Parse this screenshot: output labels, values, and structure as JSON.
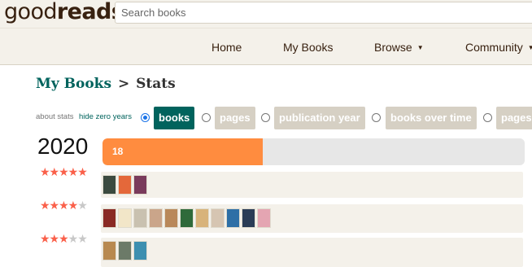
{
  "header": {
    "logo_light": "good",
    "logo_bold": "reads",
    "search_placeholder": "Search books"
  },
  "nav": {
    "home": "Home",
    "my_books": "My Books",
    "browse": "Browse",
    "community": "Community",
    "caret": "▼"
  },
  "title": {
    "crumb": "My Books",
    "separator": ">",
    "current": "Stats"
  },
  "controls": {
    "about": "about stats",
    "hide_zero": "hide zero years",
    "tabs": [
      {
        "label": "books",
        "selected": true
      },
      {
        "label": "pages",
        "selected": false
      },
      {
        "label": "publication year",
        "selected": false
      },
      {
        "label": "books over time",
        "selected": false
      },
      {
        "label": "pages",
        "selected": false
      }
    ]
  },
  "stats": {
    "year": "2020",
    "count": "18",
    "bar_fraction": 0.38,
    "accent_color": "#ff8c3f",
    "rating_rows": [
      {
        "stars": 5,
        "star_text_on": "★★★★★",
        "star_text_off": "",
        "covers": [
          "#3b4a3f",
          "#e4683a",
          "#7a3b5c"
        ]
      },
      {
        "stars": 4,
        "star_text_on": "★★★★",
        "star_text_off": "★",
        "covers": [
          "#8a2a25",
          "#f2e6c8",
          "#c9c1b0",
          "#caa58a",
          "#b9885a",
          "#2f6a3a",
          "#d8b37a",
          "#d6c5b2",
          "#2e6fa6",
          "#2a3c56",
          "#e4a5b2"
        ]
      },
      {
        "stars": 3,
        "star_text_on": "★★★",
        "star_text_off": "★★",
        "covers": [
          "#b8894f",
          "#6c7a68",
          "#3d8fb0"
        ]
      }
    ]
  }
}
